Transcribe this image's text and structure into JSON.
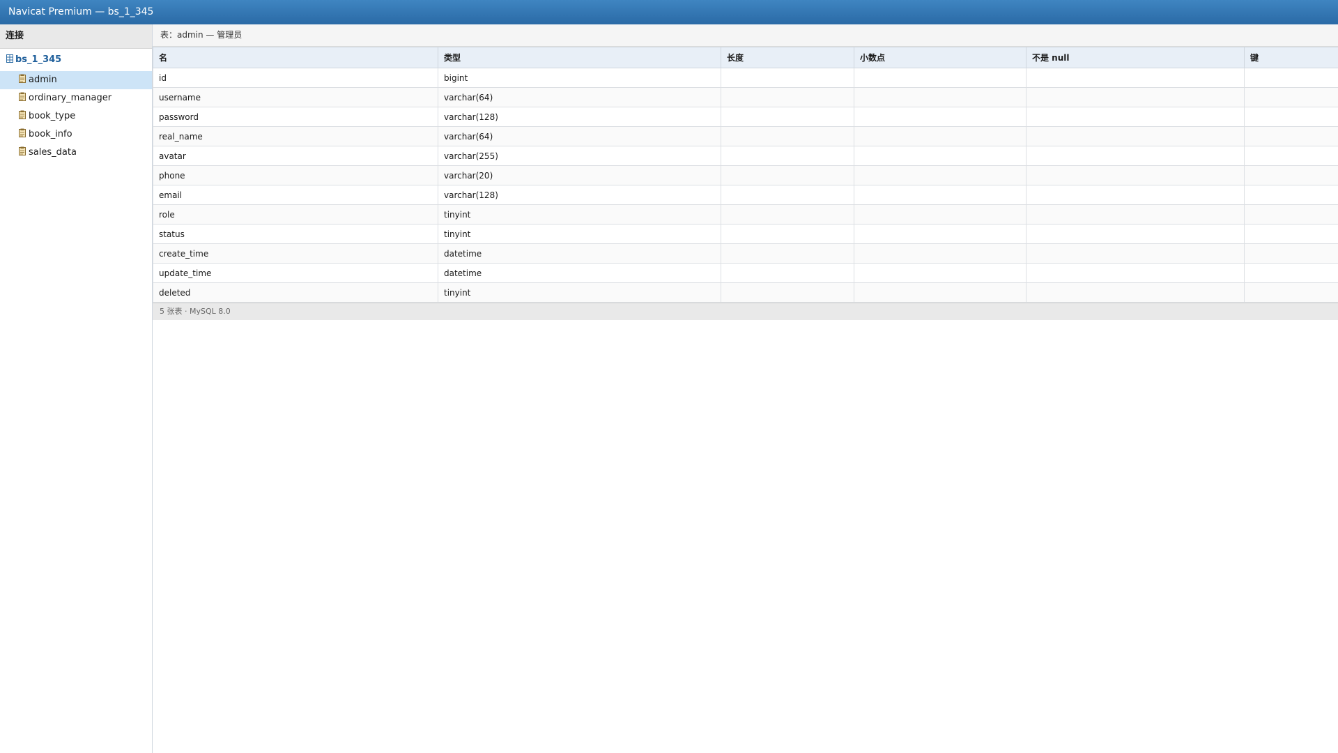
{
  "window": {
    "title": "Navicat Premium — bs_1_345"
  },
  "sidebar": {
    "header": "连接",
    "connection": {
      "name": "bs_1_345",
      "icon": "database-icon"
    },
    "items": [
      {
        "label": "admin",
        "icon": "table-icon",
        "selected": true
      },
      {
        "label": "ordinary_manager",
        "icon": "table-icon",
        "selected": false
      },
      {
        "label": "book_type",
        "icon": "table-icon",
        "selected": false
      },
      {
        "label": "book_info",
        "icon": "table-icon",
        "selected": false
      },
      {
        "label": "sales_data",
        "icon": "table-icon",
        "selected": false
      }
    ]
  },
  "main": {
    "table_title": "表：admin — 管理员",
    "columns": [
      "名",
      "类型",
      "长度",
      "小数点",
      "不是 null",
      "键"
    ],
    "rows": [
      {
        "name": "id",
        "type": "bigint",
        "length": "",
        "decimal": "",
        "not_null": "",
        "key": ""
      },
      {
        "name": "username",
        "type": "varchar(64)",
        "length": "",
        "decimal": "",
        "not_null": "",
        "key": ""
      },
      {
        "name": "password",
        "type": "varchar(128)",
        "length": "",
        "decimal": "",
        "not_null": "",
        "key": ""
      },
      {
        "name": "real_name",
        "type": "varchar(64)",
        "length": "",
        "decimal": "",
        "not_null": "",
        "key": ""
      },
      {
        "name": "avatar",
        "type": "varchar(255)",
        "length": "",
        "decimal": "",
        "not_null": "",
        "key": ""
      },
      {
        "name": "phone",
        "type": "varchar(20)",
        "length": "",
        "decimal": "",
        "not_null": "",
        "key": ""
      },
      {
        "name": "email",
        "type": "varchar(128)",
        "length": "",
        "decimal": "",
        "not_null": "",
        "key": ""
      },
      {
        "name": "role",
        "type": "tinyint",
        "length": "",
        "decimal": "",
        "not_null": "",
        "key": ""
      },
      {
        "name": "status",
        "type": "tinyint",
        "length": "",
        "decimal": "",
        "not_null": "",
        "key": ""
      },
      {
        "name": "create_time",
        "type": "datetime",
        "length": "",
        "decimal": "",
        "not_null": "",
        "key": ""
      },
      {
        "name": "update_time",
        "type": "datetime",
        "length": "",
        "decimal": "",
        "not_null": "",
        "key": ""
      },
      {
        "name": "deleted",
        "type": "tinyint",
        "length": "",
        "decimal": "",
        "not_null": "",
        "key": ""
      }
    ],
    "status": "5 张表 · MySQL 8.0"
  },
  "colors": {
    "titlebar": "#2f74b3",
    "selection": "#cde4f7",
    "header_bg": "#e8eff7",
    "connection_text": "#1f5f9b"
  }
}
